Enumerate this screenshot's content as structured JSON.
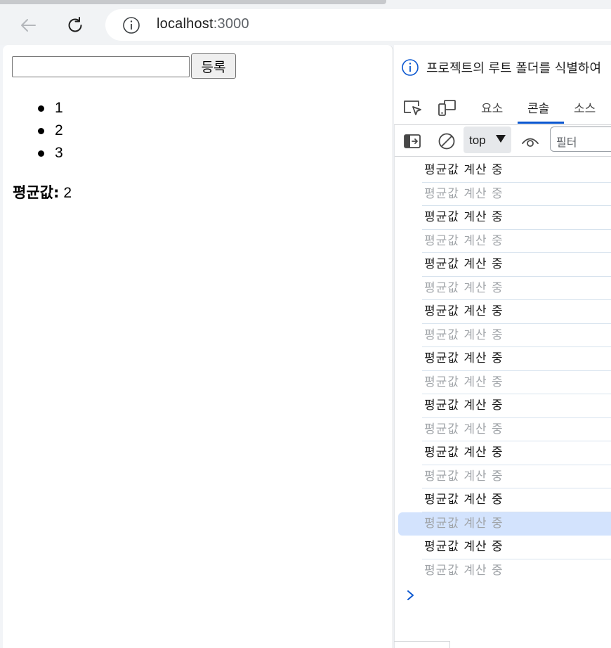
{
  "browser": {
    "address_host": "localhost",
    "address_port": ":3000"
  },
  "page": {
    "input_value": "",
    "submit_label": "등록",
    "list_items": [
      "1",
      "2",
      "3"
    ],
    "average_label": "평균값:",
    "average_value": "2"
  },
  "devtools": {
    "notice_text": "프로젝트의 루트 폴더를 식별하여",
    "tabs": {
      "elements": "요소",
      "console": "콘솔",
      "sources": "소스"
    },
    "context_value": "top",
    "filter_placeholder": "필터",
    "log_messages": [
      "평균값 계산 중",
      "평균값 계산 중",
      "평균값 계산 중",
      "평균값 계산 중",
      "평균값 계산 중",
      "평균값 계산 중",
      "평균값 계산 중",
      "평균값 계산 중",
      "평균값 계산 중",
      "평균값 계산 중",
      "평균값 계산 중",
      "평균값 계산 중",
      "평균값 계산 중",
      "평균값 계산 중",
      "평균값 계산 중",
      "평균값 계산 중",
      "평균값 계산 중",
      "평균값 계산 중"
    ]
  },
  "colors": {
    "accent": "#0b57d0",
    "selected_row": "#d3e3fd",
    "dim_text": "#a0a4a8"
  },
  "icons": {
    "back": "arrow-left-icon",
    "reload": "reload-icon",
    "site_info": "info-icon",
    "notice": "info-icon",
    "inspect": "inspect-element-icon",
    "device": "device-toolbar-icon",
    "sidebar": "console-sidebar-icon",
    "clear": "clear-console-icon",
    "live_expression": "eye-icon",
    "prompt": "chevron-right-icon"
  }
}
